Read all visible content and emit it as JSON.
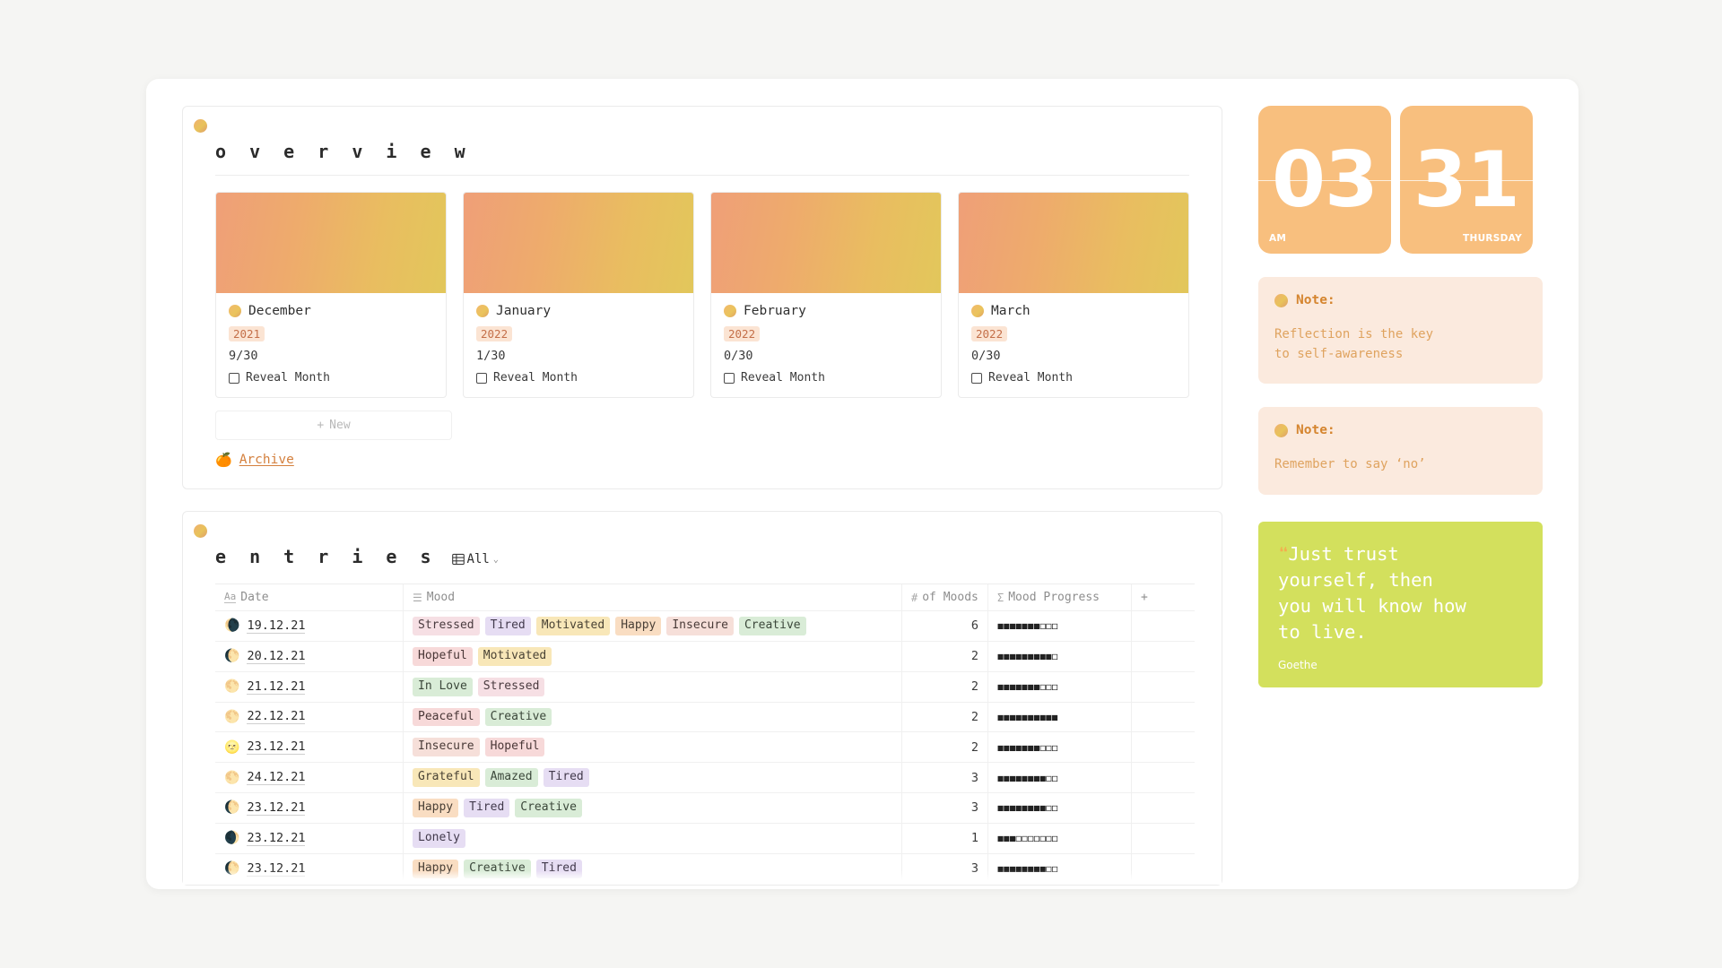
{
  "overview": {
    "dot_icon": "gradient-dot-icon",
    "title": "o v e r v i e w",
    "months": [
      {
        "emoji_icon": "orange-circle-icon",
        "name": "December",
        "year": "2021",
        "count": "9/30",
        "reveal_label": "Reveal Month"
      },
      {
        "emoji_icon": "orange-circle-icon",
        "name": "January",
        "year": "2022",
        "count": "1/30",
        "reveal_label": "Reveal Month"
      },
      {
        "emoji_icon": "orange-circle-icon",
        "name": "February",
        "year": "2022",
        "count": "0/30",
        "reveal_label": "Reveal Month"
      },
      {
        "emoji_icon": "orange-circle-icon",
        "name": "March",
        "year": "2022",
        "count": "0/30",
        "reveal_label": "Reveal Month"
      }
    ],
    "new_label": "New",
    "new_plus": "+",
    "archive_emoji": "🍊",
    "archive_label": "Archive"
  },
  "entries": {
    "dot_icon": "gradient-dot-icon",
    "title": "e n t r i e s",
    "view_icon": "table-grid-icon",
    "view_label": "All",
    "view_chevron": "⌄",
    "columns": {
      "date": {
        "icon": "Aa",
        "label": "Date"
      },
      "mood": {
        "icon": "☰",
        "label": "Mood"
      },
      "num": {
        "icon": "#",
        "label": "of Moods"
      },
      "prog": {
        "icon": "Σ",
        "label": "Mood Progress"
      },
      "add": {
        "label": "+"
      }
    },
    "rows": [
      {
        "moon": "🌘",
        "date": "19.12.21",
        "moods": [
          {
            "t": "Stressed",
            "c": "tag-pink"
          },
          {
            "t": "Tired",
            "c": "tag-purple"
          },
          {
            "t": "Motivated",
            "c": "tag-yellow"
          },
          {
            "t": "Happy",
            "c": "tag-orange"
          },
          {
            "t": "Insecure",
            "c": "tag-rose"
          },
          {
            "t": "Creative",
            "c": "tag-green"
          }
        ],
        "count": "6",
        "filled": 7,
        "total": 10
      },
      {
        "moon": "🌔",
        "date": "20.12.21",
        "moods": [
          {
            "t": "Hopeful",
            "c": "tag-red"
          },
          {
            "t": "Motivated",
            "c": "tag-yellow"
          }
        ],
        "count": "2",
        "filled": 9,
        "total": 10
      },
      {
        "moon": "🌕",
        "date": "21.12.21",
        "moods": [
          {
            "t": "In Love",
            "c": "tag-green"
          },
          {
            "t": "Stressed",
            "c": "tag-pink"
          }
        ],
        "count": "2",
        "filled": 7,
        "total": 10
      },
      {
        "moon": "🌕",
        "date": "22.12.21",
        "moods": [
          {
            "t": "Peaceful",
            "c": "tag-red"
          },
          {
            "t": "Creative",
            "c": "tag-green"
          }
        ],
        "count": "2",
        "filled": 10,
        "total": 10
      },
      {
        "moon": "🌝",
        "date": "23.12.21",
        "moods": [
          {
            "t": "Insecure",
            "c": "tag-rose"
          },
          {
            "t": "Hopeful",
            "c": "tag-red"
          }
        ],
        "count": "2",
        "filled": 7,
        "total": 10
      },
      {
        "moon": "🌕",
        "date": "24.12.21",
        "moods": [
          {
            "t": "Grateful",
            "c": "tag-yellow"
          },
          {
            "t": "Amazed",
            "c": "tag-green"
          },
          {
            "t": "Tired",
            "c": "tag-purple"
          }
        ],
        "count": "3",
        "filled": 8,
        "total": 10
      },
      {
        "moon": "🌔",
        "date": "23.12.21",
        "moods": [
          {
            "t": "Happy",
            "c": "tag-orange"
          },
          {
            "t": "Tired",
            "c": "tag-purple"
          },
          {
            "t": "Creative",
            "c": "tag-green"
          }
        ],
        "count": "3",
        "filled": 8,
        "total": 10
      },
      {
        "moon": "🌒",
        "date": "23.12.21",
        "moods": [
          {
            "t": "Lonely",
            "c": "tag-purple"
          }
        ],
        "count": "1",
        "filled": 3,
        "total": 10
      },
      {
        "moon": "🌔",
        "date": "23.12.21",
        "moods": [
          {
            "t": "Happy",
            "c": "tag-orange"
          },
          {
            "t": "Creative",
            "c": "tag-green"
          },
          {
            "t": "Tired",
            "c": "tag-purple"
          }
        ],
        "count": "3",
        "filled": 8,
        "total": 10
      }
    ]
  },
  "clock": {
    "hour": "03",
    "meridiem": "AM",
    "day": "31",
    "weekday": "THURSDAY",
    "panel_color": "#f8bf7e"
  },
  "notes": [
    {
      "dot_icon": "gradient-dot-icon",
      "title": "Note:",
      "body": "Reflection is the key\nto self-awareness"
    },
    {
      "dot_icon": "gradient-dot-icon",
      "title": "Note:",
      "body": "Remember to say ‘no’"
    }
  ],
  "quote": {
    "mark": "❝",
    "text": "Just trust\nyourself, then\nyou will know how\nto live.",
    "author": "Goethe",
    "bg_color": "#d3e05d"
  },
  "colors": {
    "accent_orange": "#d5852f",
    "badge_bg": "#fbe4df",
    "note_bg": "#fbeade",
    "quote_bg": "#d3e05d",
    "page_bg": "#f5f5f3"
  }
}
